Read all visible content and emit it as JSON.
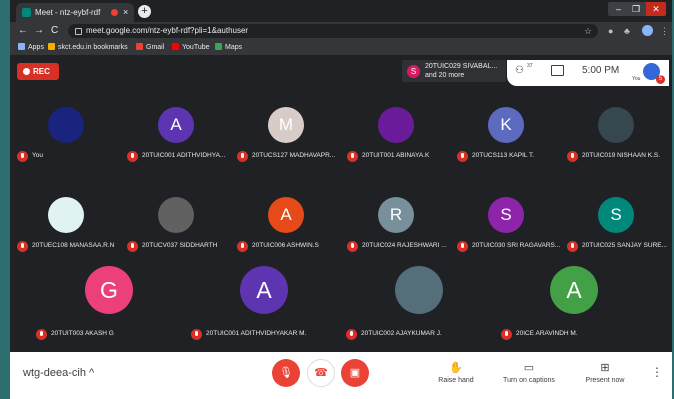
{
  "browser": {
    "tab_title": "Meet - ntz-eybf-rdf",
    "tab_close": "×",
    "new_tab": "+",
    "win_min": "–",
    "win_max": "❐",
    "win_close": "✕",
    "back": "←",
    "forward": "→",
    "reload": "C",
    "url": "meet.google.com/ntz-eybf-rdf?pli=1&authuser",
    "star": "☆",
    "ext_puzzle": "♣",
    "menu": "⋮",
    "bookmarks": {
      "apps": "Apps",
      "items": [
        "skct.edu.in bookmarks",
        "Gmail",
        "YouTube",
        "Maps"
      ]
    }
  },
  "meet": {
    "rec_label": "REC",
    "presenter": {
      "initial": "S",
      "line1": "20TUIC029 SIVABAL...",
      "line2": "and 20 more"
    },
    "people_count": "37",
    "people_icon": "people-icon",
    "time": "5:00 PM",
    "you_label": "You",
    "notif_count": "5",
    "rows": [
      [
        {
          "name": "You",
          "initial": "",
          "color": "#1a237e"
        },
        {
          "name": "20TUIC001 ADITHVIDHYA...",
          "initial": "A",
          "color": "#5e35b1"
        },
        {
          "name": "20TUCS127 MADHAVAPR...",
          "initial": "M",
          "color": "#d7ccc8"
        },
        {
          "name": "20TUIT001 ABINAYA.K",
          "initial": "",
          "color": "#6a1b9a"
        },
        {
          "name": "20TUCS113 KAPIL T.",
          "initial": "K",
          "color": "#5c6bc0"
        },
        {
          "name": "20TUIC019 NISHAAN K.S.",
          "initial": "",
          "color": "#37474f"
        }
      ],
      [
        {
          "name": "20TUEC108 MANASAA.R.N",
          "initial": "",
          "color": "#e0f2f1"
        },
        {
          "name": "20TUCV037 SIDDHARTH",
          "initial": "",
          "color": "#616161"
        },
        {
          "name": "20TUIC006 ASHWIN.S",
          "initial": "A",
          "color": "#e64a19"
        },
        {
          "name": "20TUIC024 RAJESHWARI ...",
          "initial": "R",
          "color": "#78909c"
        },
        {
          "name": "20TUIC030 SRI RAGAVARS...",
          "initial": "S",
          "color": "#8e24aa"
        },
        {
          "name": "20TUIC025 SANJAY SURE...",
          "initial": "S",
          "color": "#00897b"
        }
      ]
    ],
    "big_row": [
      {
        "name": "20TUIT003 AKASH G",
        "initial": "G",
        "color": "#ec407a"
      },
      {
        "name": "20TUIC001 ADITHVIDHYAKAR M.",
        "initial": "A",
        "color": "#5e35b1"
      },
      {
        "name": "20TUIC002 AJAYKUMAR J.",
        "initial": "",
        "color": "#546e7a"
      },
      {
        "name": "20ICE ARAVINDH M.",
        "initial": "A",
        "color": "#43a047"
      }
    ]
  },
  "bottom": {
    "meeting_code": "wtg-deea-cih",
    "chevron": "^",
    "mic_icon": "mic-off-icon",
    "hangup_icon": "hangup-icon",
    "cam_icon": "camera-off-icon",
    "actions": [
      {
        "label": "Raise hand",
        "symbol": "✋"
      },
      {
        "label": "Turn on captions",
        "symbol": "▭"
      },
      {
        "label": "Present now",
        "symbol": "⊞"
      }
    ],
    "more": "⋮"
  }
}
